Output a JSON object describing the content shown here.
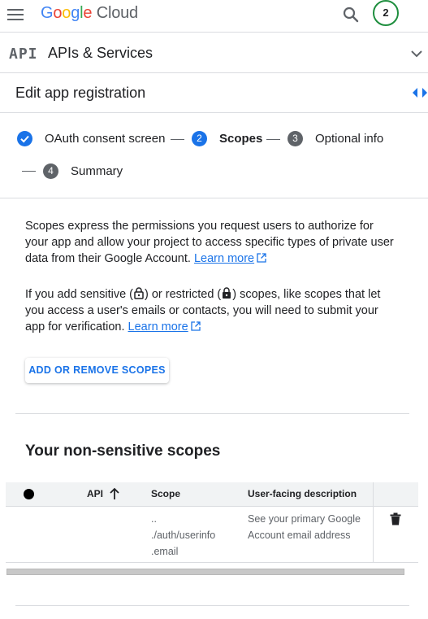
{
  "topbar": {
    "logo_letters": [
      "G",
      "o",
      "o",
      "g",
      "l",
      "e"
    ],
    "logo_suffix": "Cloud",
    "notification_count": "2"
  },
  "api_bar": {
    "logo": "API",
    "title": "APIs & Services"
  },
  "edit_bar": {
    "title": "Edit app registration"
  },
  "stepper": {
    "steps": [
      {
        "number": "1",
        "label": "OAuth consent screen",
        "state": "done"
      },
      {
        "number": "2",
        "label": "Scopes",
        "state": "active"
      },
      {
        "number": "3",
        "label": "Optional info",
        "state": "inactive"
      },
      {
        "number": "4",
        "label": "Summary",
        "state": "inactive"
      }
    ]
  },
  "intro": {
    "para1": "Scopes express the permissions you request users to authorize for your app and allow your project to access specific types of private user data from their Google Account.",
    "para1_link": "Learn more",
    "para2_a": "If you add sensitive (",
    "para2_b": ") or restricted (",
    "para2_c": ") scopes, like scopes that let you access a user's emails or contacts, you will need to submit your app for verification.",
    "para2_link": "Learn more"
  },
  "scopes_button": {
    "label": "ADD OR REMOVE SCOPES"
  },
  "non_sensitive": {
    "title": "Your non-sensitive scopes",
    "columns": [
      "API",
      "Scope",
      "User-facing description"
    ],
    "rows": [
      {
        "api": "",
        "scope_lines": [
          "..",
          "./auth/userinfo",
          ".email"
        ],
        "description_lines": [
          "See your primary Google",
          "Account email address"
        ]
      }
    ]
  },
  "colors": {
    "accent": "#1a73e8",
    "badge_ring": "#1e8e3e",
    "inactive_step": "#5f6368",
    "header_bg": "#f1f3f4"
  }
}
